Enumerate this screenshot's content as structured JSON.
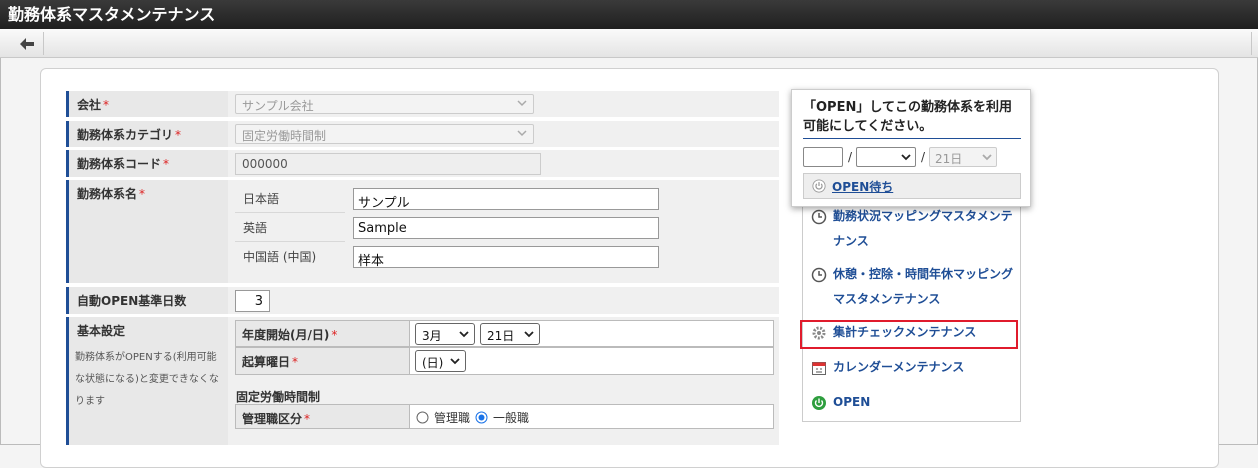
{
  "window": {
    "title": "勤務体系マスタメンテナンス"
  },
  "toolbar": {
    "back_icon": "arrow-left-icon"
  },
  "form": {
    "company": {
      "label": "会社",
      "required_mark": "*",
      "value": "サンプル会社"
    },
    "category": {
      "label": "勤務体系カテゴリ",
      "required_mark": "*",
      "value": "固定労働時間制"
    },
    "code": {
      "label": "勤務体系コード",
      "required_mark": "*",
      "value": "000000"
    },
    "name": {
      "label": "勤務体系名",
      "required_mark": "*",
      "locales": [
        {
          "label": "日本語",
          "value": "サンプル"
        },
        {
          "label": "英語",
          "value": "Sample"
        },
        {
          "label": "中国語 (中国)",
          "value": "样本"
        }
      ]
    },
    "auto_open": {
      "label": "自動OPEN基準日数",
      "value": "3"
    },
    "basic": {
      "label": "基本設定",
      "note": "勤務体系がOPENする(利用可能な状態になる)と変更できなくなります",
      "year_start": {
        "label": "年度開始(月/日)",
        "required_mark": "*",
        "month": "3月",
        "day": "21日"
      },
      "start_weekday": {
        "label": "起算曜日",
        "required_mark": "*",
        "value": "(日)"
      },
      "fixed_section": "固定労働時間制",
      "manager_type": {
        "label": "管理職区分",
        "required_mark": "*",
        "option_manager": "管理職",
        "option_general": "一般職",
        "selected": "一般職"
      }
    }
  },
  "popup": {
    "message": "「OPEN」してこの勤務体系を利用可能にしてください。",
    "date_day": "21日",
    "status_label": "OPEN待ち"
  },
  "menu": {
    "items": [
      {
        "label": "勤務状況マッピングマスタメンテナンス",
        "icon": "clock-icon"
      },
      {
        "label": "休憩・控除・時間年休マッピングマスタメンテナンス",
        "icon": "clock-icon"
      },
      {
        "label": "集計チェックメンテナンス",
        "icon": "gear-icon"
      },
      {
        "label": "カレンダーメンテナンス",
        "icon": "calendar-icon"
      },
      {
        "label": "OPEN",
        "icon": "power-icon"
      }
    ]
  },
  "colors": {
    "accent": "#1f4e96",
    "required": "#dd2222",
    "highlight": "#e01b2c"
  }
}
